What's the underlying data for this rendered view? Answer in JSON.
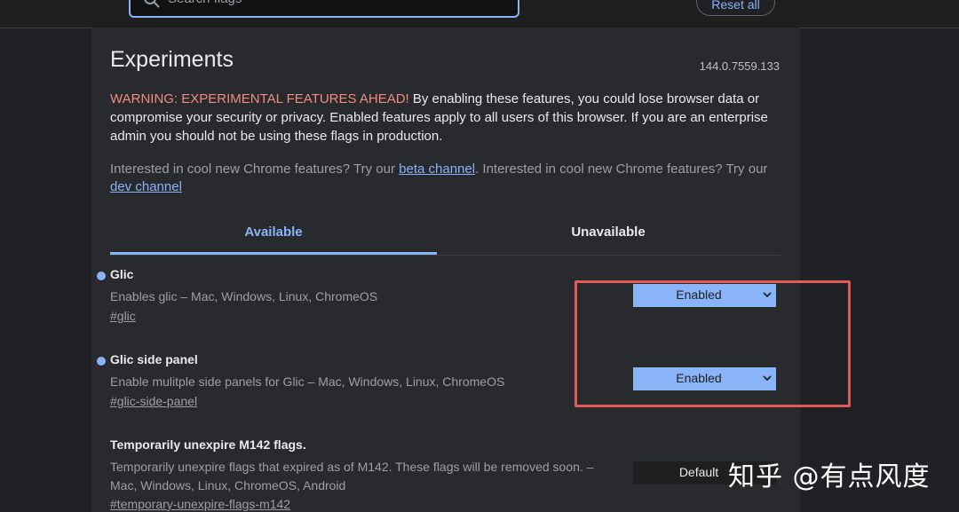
{
  "header": {
    "search_placeholder": "Search flags",
    "reset_label": "Reset all"
  },
  "page": {
    "title": "Experiments",
    "version": "144.0.7559.133",
    "warning_head": "WARNING: EXPERIMENTAL FEATURES AHEAD!",
    "warning_body": " By enabling these features, you could lose browser data or compromise your security or privacy. Enabled features apply to all users of this browser. If you are an enterprise admin you should not be using these flags in production.",
    "interest_1": "Interested in cool new Chrome features? Try our ",
    "beta_link": "beta channel",
    "interest_2": ". Interested in cool new Chrome features? Try our ",
    "dev_link": "dev channel"
  },
  "tabs": [
    {
      "label": "Available"
    },
    {
      "label": "Unavailable"
    }
  ],
  "flags": [
    {
      "name": "Glic",
      "description": "Enables glic – Mac, Windows, Linux, ChromeOS",
      "link": "#glic",
      "value": "Enabled"
    },
    {
      "name": "Glic side panel",
      "description": "Enable mulitple side panels for Glic – Mac, Windows, Linux, ChromeOS",
      "link": "#glic-side-panel",
      "value": "Enabled"
    },
    {
      "name": "Temporarily unexpire M142 flags.",
      "description": "Temporarily unexpire flags that expired as of M142. These flags will be removed soon. – Mac, Windows, Linux, ChromeOS, Android",
      "link": "#temporary-unexpire-flags-m142",
      "value": "Default"
    }
  ],
  "watermark": "知乎 @有点风度",
  "colors": {
    "accent": "#8ab4f8",
    "warning": "#f28b82",
    "highlight": "#e05a5a"
  }
}
